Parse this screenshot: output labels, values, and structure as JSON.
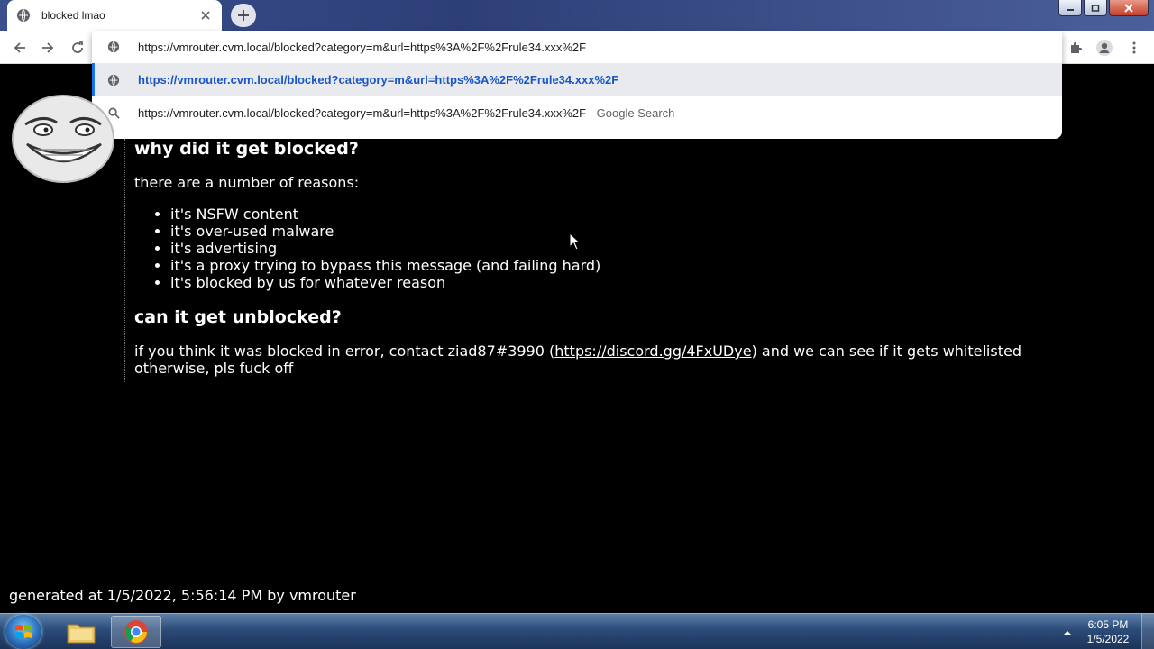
{
  "browser": {
    "tab_title": "blocked lmao",
    "omnibox_text": "https://vmrouter.cvm.local/blocked?category=m&url=https%3A%2F%2Frule34.xxx%2F",
    "suggestions": [
      {
        "text": "https://vmrouter.cvm.local/blocked?category=m&url=https%3A%2F%2Frule34.xxx%2F",
        "icon": "globe-icon"
      },
      {
        "text": "https://vmrouter.cvm.local/blocked?category=m&url=https%3A%2F%2Frule34.xxx%2F",
        "suffix": " - Google Search",
        "icon": "search-icon"
      }
    ]
  },
  "page": {
    "why_heading": "why did it get blocked?",
    "reasons_intro": "there are a number of reasons:",
    "reasons": [
      "it's NSFW content",
      "it's over-used malware",
      "it's advertising",
      "it's a proxy trying to bypass this message (and failing hard)",
      "it's blocked by us for whatever reason"
    ],
    "unblock_heading": "can it get unblocked?",
    "contact_prefix": "if you think it was blocked in error, contact ziad87#3990 (",
    "contact_link": "https://discord.gg/4FxUDye",
    "contact_suffix": ") and we can see if it gets whitelisted",
    "contact_line2": "otherwise, pls fuck off",
    "footer": "generated at 1/5/2022, 5:56:14 PM by vmrouter"
  },
  "taskbar": {
    "time": "6:05 PM",
    "date": "1/5/2022"
  },
  "colors": {
    "page_bg": "#000000",
    "text": "#ffffff",
    "selected_suggestion": "#1a56c8",
    "accent_bar": "#1a73e8"
  }
}
